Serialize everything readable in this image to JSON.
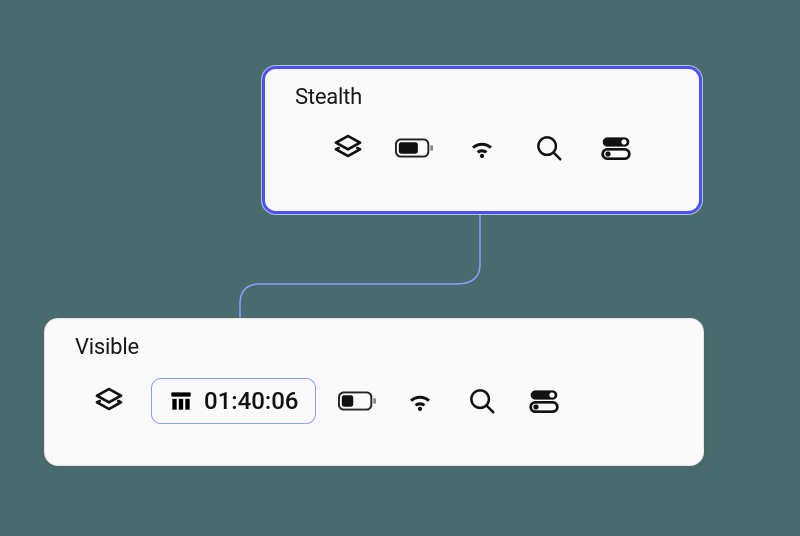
{
  "stealth": {
    "title": "Stealth"
  },
  "visible": {
    "title": "Visible",
    "timer": "01:40:06"
  }
}
